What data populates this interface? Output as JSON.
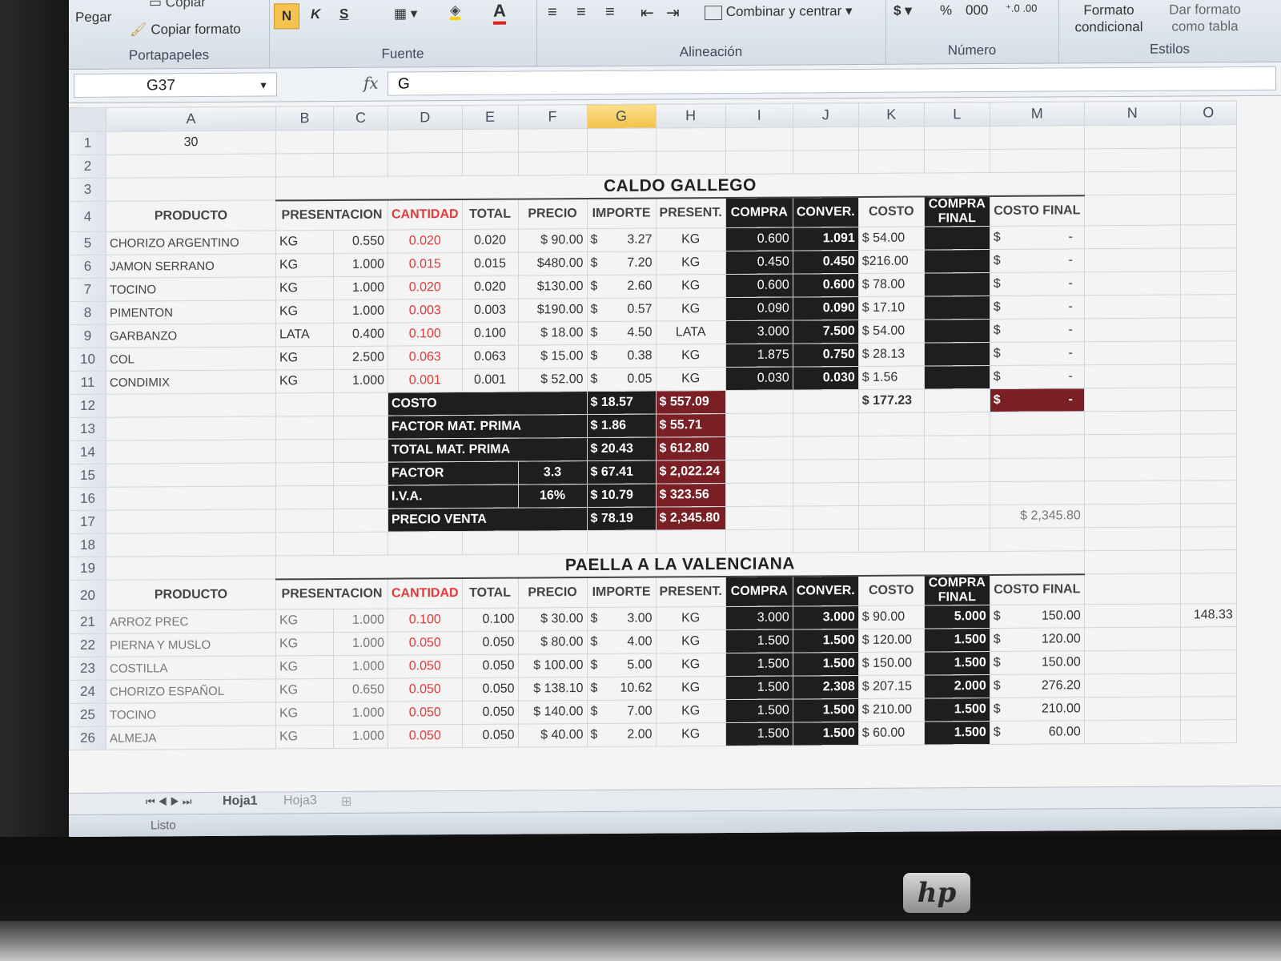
{
  "ribbon": {
    "clipboard": {
      "label": "Portapapeles",
      "paste": "Pegar",
      "copy": "Copiar",
      "format_painter": "Copiar formato"
    },
    "font": {
      "label": "Fuente",
      "bold": "N",
      "italic": "K",
      "underline": "S",
      "font_color_letter": "A"
    },
    "alignment": {
      "label": "Alineación",
      "merge_center": "Combinar y centrar"
    },
    "number": {
      "label": "Número",
      "currency": "$",
      "percent": "%",
      "thousands": "000"
    },
    "styles": {
      "label": "Estilos",
      "conditional": "Formato condicional",
      "format_table": "Dar formato como tabla"
    }
  },
  "formula_bar": {
    "name_box": "G37",
    "formula": "G",
    "fx": "fx"
  },
  "columns": [
    "A",
    "B",
    "C",
    "D",
    "E",
    "F",
    "G",
    "H",
    "I",
    "J",
    "K",
    "L",
    "M",
    "N",
    "O"
  ],
  "selected_column": "G",
  "cell_a1": "30",
  "caldo": {
    "title": "CALDO GALLEGO",
    "headers": [
      "PRODUCTO",
      "PRESENTACION",
      "CANTIDAD",
      "TOTAL",
      "PRECIO",
      "IMPORTE",
      "PRESENT.",
      "COMPRA",
      "CONVER.",
      "COSTO",
      "COMPRA FINAL",
      "COSTO FINAL"
    ],
    "rows": [
      {
        "n": "5",
        "prod": "CHORIZO ARGENTINO",
        "pres": "KG",
        "c": "0.550",
        "cant": "0.020",
        "total": "0.020",
        "precio": "$ 90.00",
        "imp_s": "$",
        "imp": "3.27",
        "present": "KG",
        "compra": "0.600",
        "conver": "1.091",
        "costo": "$  54.00",
        "final_s": "$",
        "final": "-"
      },
      {
        "n": "6",
        "prod": "JAMON SERRANO",
        "pres": "KG",
        "c": "1.000",
        "cant": "0.015",
        "total": "0.015",
        "precio": "$480.00",
        "imp_s": "$",
        "imp": "7.20",
        "present": "KG",
        "compra": "0.450",
        "conver": "0.450",
        "costo": "$216.00",
        "final_s": "$",
        "final": "-"
      },
      {
        "n": "7",
        "prod": "TOCINO",
        "pres": "KG",
        "c": "1.000",
        "cant": "0.020",
        "total": "0.020",
        "precio": "$130.00",
        "imp_s": "$",
        "imp": "2.60",
        "present": "KG",
        "compra": "0.600",
        "conver": "0.600",
        "costo": "$  78.00",
        "final_s": "$",
        "final": "-"
      },
      {
        "n": "8",
        "prod": "PIMENTON",
        "pres": "KG",
        "c": "1.000",
        "cant": "0.003",
        "total": "0.003",
        "precio": "$190.00",
        "imp_s": "$",
        "imp": "0.57",
        "present": "KG",
        "compra": "0.090",
        "conver": "0.090",
        "costo": "$  17.10",
        "final_s": "$",
        "final": "-"
      },
      {
        "n": "9",
        "prod": "GARBANZO",
        "pres": "LATA",
        "c": "0.400",
        "cant": "0.100",
        "total": "0.100",
        "precio": "$  18.00",
        "imp_s": "$",
        "imp": "4.50",
        "present": "LATA",
        "compra": "3.000",
        "conver": "7.500",
        "costo": "$  54.00",
        "final_s": "$",
        "final": "-"
      },
      {
        "n": "10",
        "prod": "COL",
        "pres": "KG",
        "c": "2.500",
        "cant": "0.063",
        "total": "0.063",
        "precio": "$  15.00",
        "imp_s": "$",
        "imp": "0.38",
        "present": "KG",
        "compra": "1.875",
        "conver": "0.750",
        "costo": "$  28.13",
        "final_s": "$",
        "final": "-"
      },
      {
        "n": "11",
        "prod": "CONDIMIX",
        "pres": "KG",
        "c": "1.000",
        "cant": "0.001",
        "total": "0.001",
        "precio": "$  52.00",
        "imp_s": "$",
        "imp": "0.05",
        "present": "KG",
        "compra": "0.030",
        "conver": "0.030",
        "costo": "$    1.56",
        "final_s": "$",
        "final": "-"
      }
    ],
    "summary": [
      {
        "n": "12",
        "label": "COSTO",
        "extra": "",
        "g": "$   18.57",
        "h": "$   557.09"
      },
      {
        "n": "13",
        "label": "FACTOR MAT. PRIMA",
        "extra": "",
        "g": "$     1.86",
        "h": "$     55.71"
      },
      {
        "n": "14",
        "label": "TOTAL MAT. PRIMA",
        "extra": "",
        "g": "$   20.43",
        "h": "$   612.80"
      },
      {
        "n": "15",
        "label": "FACTOR",
        "extra": "3.3",
        "g": "$   67.41",
        "h": "$ 2,022.24"
      },
      {
        "n": "16",
        "label": "I.V.A.",
        "extra": "16%",
        "g": "$   10.79",
        "h": "$   323.56"
      },
      {
        "n": "17",
        "label": "PRECIO VENTA",
        "extra": "",
        "g": "$   78.19",
        "h": "$ 2,345.80"
      }
    ],
    "costo_total": "$ 177.23",
    "costo_final_total_s": "$",
    "costo_final_total": "-",
    "m17": "$  2,345.80"
  },
  "paella": {
    "title": "PAELLA A LA VALENCIANA",
    "headers": [
      "PRODUCTO",
      "PRESENTACION",
      "CANTIDAD",
      "TOTAL",
      "PRECIO",
      "IMPORTE",
      "PRESENT.",
      "COMPRA",
      "CONVER.",
      "COSTO",
      "COMPRA FINAL",
      "COSTO FINAL"
    ],
    "rows": [
      {
        "n": "21",
        "prod": "ARROZ PREC",
        "pres": "KG",
        "c": "1.000",
        "cant": "0.100",
        "total": "0.100",
        "precio": "$  30.00",
        "imp_s": "$",
        "imp": "3.00",
        "present": "KG",
        "compra": "3.000",
        "conver": "3.000",
        "costo": "$  90.00",
        "final": "5.000",
        "cf_s": "$",
        "cf": "150.00"
      },
      {
        "n": "22",
        "prod": "PIERNA Y MUSLO",
        "pres": "KG",
        "c": "1.000",
        "cant": "0.050",
        "total": "0.050",
        "precio": "$  80.00",
        "imp_s": "$",
        "imp": "4.00",
        "present": "KG",
        "compra": "1.500",
        "conver": "1.500",
        "costo": "$ 120.00",
        "final": "1.500",
        "cf_s": "$",
        "cf": "120.00"
      },
      {
        "n": "23",
        "prod": "COSTILLA",
        "pres": "KG",
        "c": "1.000",
        "cant": "0.050",
        "total": "0.050",
        "precio": "$ 100.00",
        "imp_s": "$",
        "imp": "5.00",
        "present": "KG",
        "compra": "1.500",
        "conver": "1.500",
        "costo": "$ 150.00",
        "final": "1.500",
        "cf_s": "$",
        "cf": "150.00"
      },
      {
        "n": "24",
        "prod": "CHORIZO ESPAÑOL",
        "pres": "KG",
        "c": "0.650",
        "cant": "0.050",
        "total": "0.050",
        "precio": "$ 138.10",
        "imp_s": "$",
        "imp": "10.62",
        "present": "KG",
        "compra": "1.500",
        "conver": "2.308",
        "costo": "$ 207.15",
        "final": "2.000",
        "cf_s": "$",
        "cf": "276.20"
      },
      {
        "n": "25",
        "prod": "TOCINO",
        "pres": "KG",
        "c": "1.000",
        "cant": "0.050",
        "total": "0.050",
        "precio": "$ 140.00",
        "imp_s": "$",
        "imp": "7.00",
        "present": "KG",
        "compra": "1.500",
        "conver": "1.500",
        "costo": "$ 210.00",
        "final": "1.500",
        "cf_s": "$",
        "cf": "210.00"
      },
      {
        "n": "26",
        "prod": "ALMEJA",
        "pres": "KG",
        "c": "1.000",
        "cant": "0.050",
        "total": "0.050",
        "precio": "$  40.00",
        "imp_s": "$",
        "imp": "2.00",
        "present": "KG",
        "compra": "1.500",
        "conver": "1.500",
        "costo": "$  60.00",
        "final": "1.500",
        "cf_s": "$",
        "cf": "60.00"
      }
    ],
    "n21": "148.33"
  },
  "tabs": [
    "Hoja1",
    "Hoja3"
  ],
  "status": "Listo",
  "brand": "hp",
  "colors": {
    "header_dark": "#1e1e1e",
    "maroon": "#7a1f24",
    "red_text": "#e03a3a",
    "selected_col": "#f2c24a"
  }
}
